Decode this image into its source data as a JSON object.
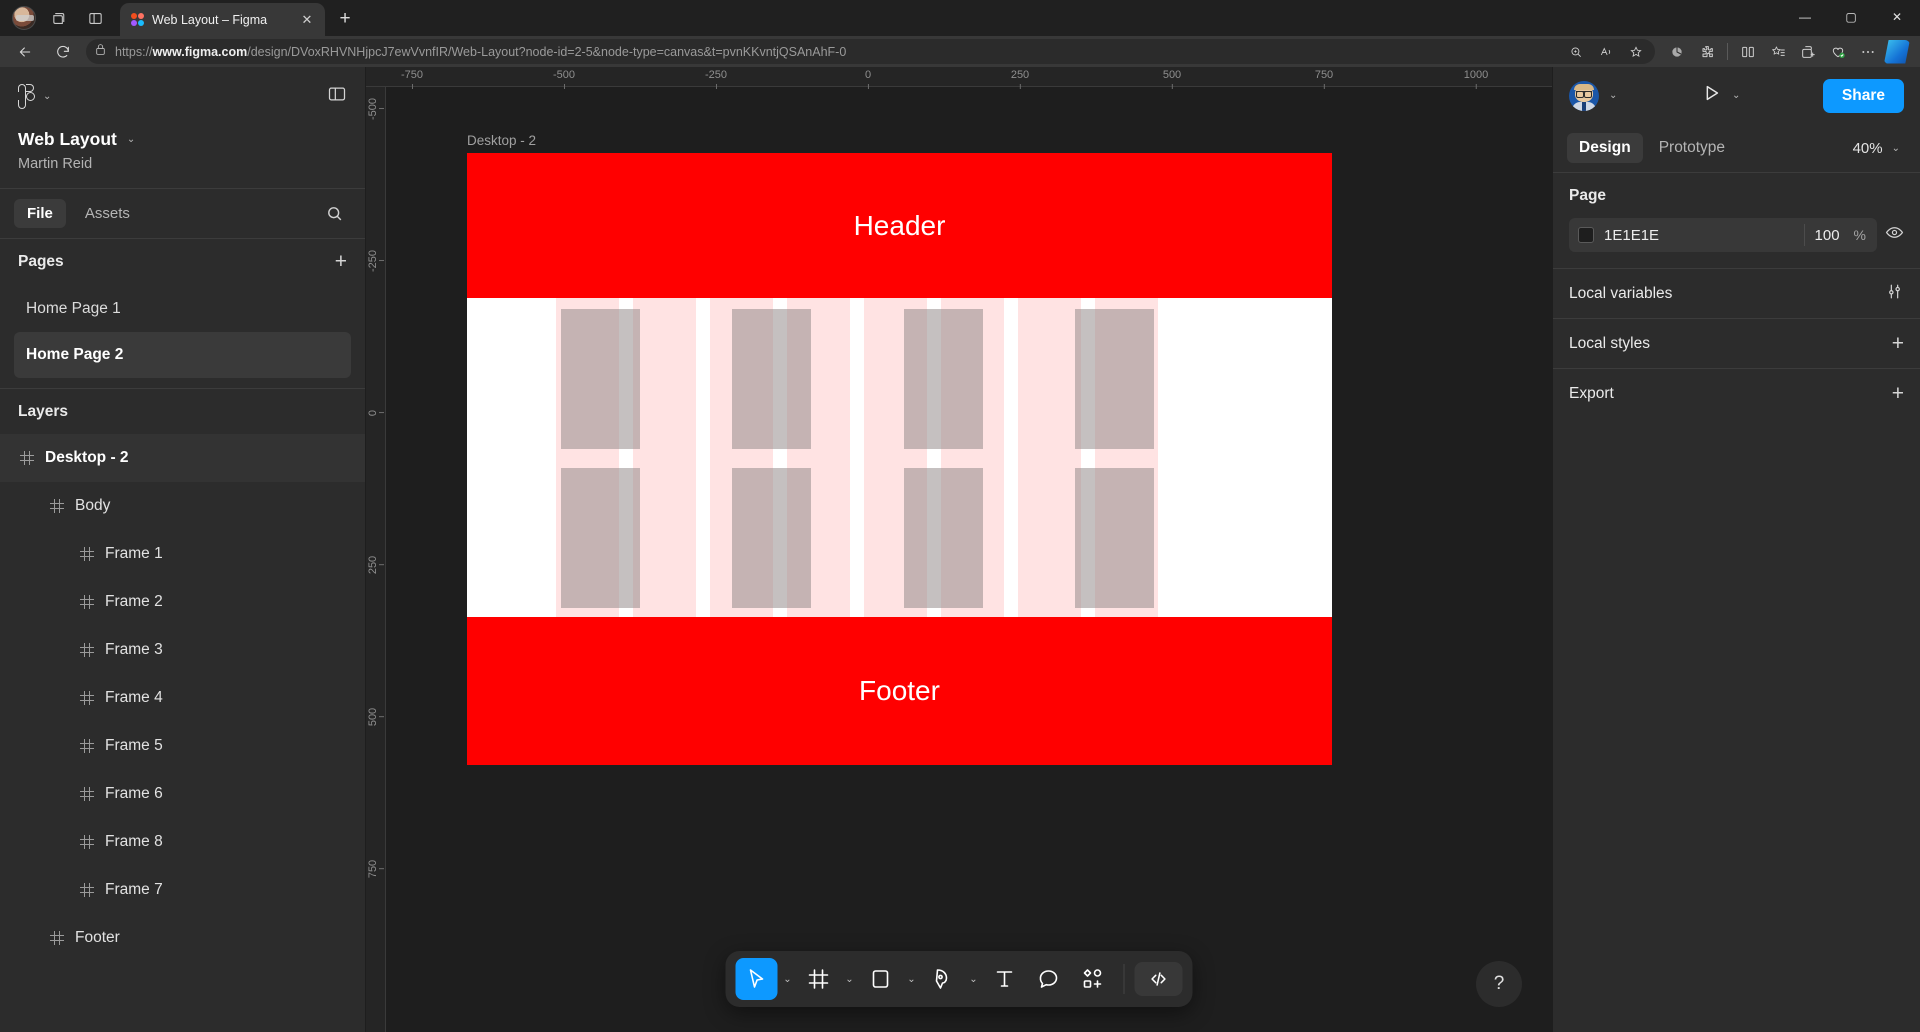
{
  "browser": {
    "tab": {
      "title": "Web Layout – Figma",
      "close_label": "✕"
    },
    "newtab_label": "+",
    "url_prefix": "https://",
    "url_domain": "www.figma.com",
    "url_path": "/design/DVoxRHVNHjpcJ7ewVvnfIR/Web-Layout?node-id=2-5&node-type=canvas&t=pvnKKvntjQSAnAhF-0",
    "window_controls": {
      "minimize": "—",
      "maximize": "▢",
      "close": "✕"
    }
  },
  "left_panel": {
    "file_name": "Web Layout",
    "owner": "Martin Reid",
    "tabs": [
      {
        "label": "File",
        "active": true
      },
      {
        "label": "Assets",
        "active": false
      }
    ],
    "pages_title": "Pages",
    "pages": [
      {
        "label": "Home Page 1",
        "selected": false
      },
      {
        "label": "Home Page 2",
        "selected": true
      }
    ],
    "layers_title": "Layers",
    "layers": [
      {
        "label": "Desktop - 2",
        "depth": 0,
        "selected": true
      },
      {
        "label": "Body",
        "depth": 1,
        "selected": false
      },
      {
        "label": "Frame 1",
        "depth": 2,
        "selected": false
      },
      {
        "label": "Frame 2",
        "depth": 2,
        "selected": false
      },
      {
        "label": "Frame 3",
        "depth": 2,
        "selected": false
      },
      {
        "label": "Frame 4",
        "depth": 2,
        "selected": false
      },
      {
        "label": "Frame 5",
        "depth": 2,
        "selected": false
      },
      {
        "label": "Frame 6",
        "depth": 2,
        "selected": false
      },
      {
        "label": "Frame 8",
        "depth": 2,
        "selected": false
      },
      {
        "label": "Frame 7",
        "depth": 2,
        "selected": false
      },
      {
        "label": "Footer",
        "depth": 1,
        "selected": false
      }
    ]
  },
  "canvas": {
    "ruler_h": [
      "-750",
      "-500",
      "-250",
      "0",
      "250",
      "500",
      "750",
      "1000"
    ],
    "ruler_v": [
      "-500",
      "-250",
      "0",
      "250",
      "500",
      "750"
    ],
    "artboard_label": "Desktop - 2",
    "header_text": "Header",
    "footer_text": "Footer"
  },
  "toolbar": {
    "tools": [
      {
        "name": "move-tool",
        "active": true,
        "caret": true
      },
      {
        "name": "frame-tool",
        "active": false,
        "caret": true
      },
      {
        "name": "shape-tool",
        "active": false,
        "caret": true
      },
      {
        "name": "pen-tool",
        "active": false,
        "caret": true
      },
      {
        "name": "text-tool",
        "active": false,
        "caret": false
      },
      {
        "name": "comment-tool",
        "active": false,
        "caret": false
      },
      {
        "name": "actions-tool",
        "active": false,
        "caret": false
      }
    ],
    "devmode_label": "</>"
  },
  "right_panel": {
    "share_label": "Share",
    "tabs": [
      {
        "label": "Design",
        "active": true
      },
      {
        "label": "Prototype",
        "active": false
      }
    ],
    "zoom": "40%",
    "page_section_title": "Page",
    "page_fill_hex": "1E1E1E",
    "page_fill_opacity": "100",
    "opacity_unit": "%",
    "sections": [
      {
        "label": "Local variables",
        "icon": "sliders-icon"
      },
      {
        "label": "Local styles",
        "icon": "plus-icon"
      },
      {
        "label": "Export",
        "icon": "plus-icon"
      }
    ]
  },
  "help_label": "?",
  "colors": {
    "accent": "#0d99ff",
    "artboard_red": "#ff0000",
    "canvas_bg": "#1e1e1e",
    "panel_bg": "#2c2c2c"
  }
}
